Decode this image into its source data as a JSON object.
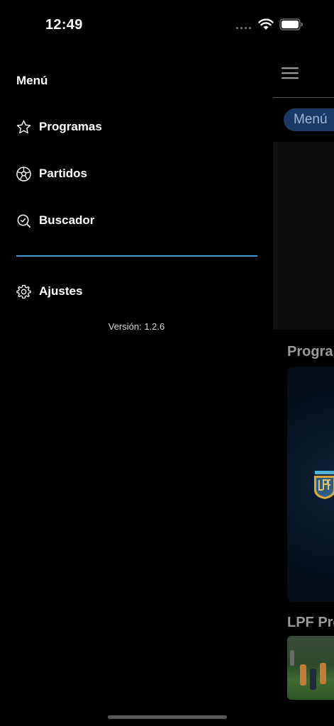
{
  "status_bar": {
    "time": "12:49"
  },
  "drawer": {
    "title": "Menú",
    "items": [
      {
        "label": "Programas",
        "icon": "star-icon"
      },
      {
        "label": "Partidos",
        "icon": "soccer-ball-icon"
      },
      {
        "label": "Buscador",
        "icon": "search-icon"
      }
    ],
    "settings": {
      "label": "Ajustes",
      "icon": "gear-icon"
    },
    "version": "Versión: 1.2.6"
  },
  "main": {
    "chip_label": "Menú",
    "sections": [
      {
        "title": "Progra"
      },
      {
        "title": "LPF Pro"
      }
    ]
  },
  "colors": {
    "accent_divider": "#3f9ad9",
    "chip_bg": "#1a3a66"
  }
}
